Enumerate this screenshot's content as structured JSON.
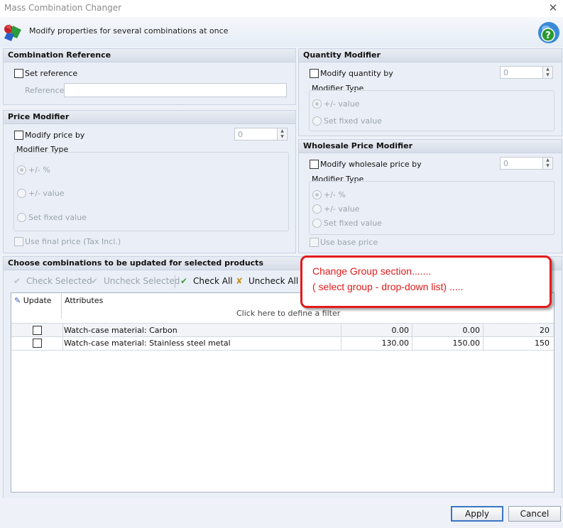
{
  "window": {
    "title": "Mass Combination Changer",
    "close_glyph": "✕"
  },
  "header": {
    "description": "Modify properties for several combinations at once",
    "help_glyph": "?"
  },
  "combination_reference": {
    "title": "Combination Reference",
    "set_reference_label": "Set reference",
    "reference_label": "Reference",
    "reference_value": ""
  },
  "price_modifier": {
    "title": "Price Modifier",
    "modify_label": "Modify price by",
    "value": "0",
    "modifier_type_label": "Modifier Type",
    "options": [
      "+/- %",
      "+/- value",
      "Set fixed value"
    ],
    "use_final_price_label": "Use final price (Tax Incl.)"
  },
  "quantity_modifier": {
    "title": "Quantity Modifier",
    "modify_label": "Modify quantity by",
    "value": "0",
    "modifier_type_label": "Modifier Type",
    "options": [
      "+/- value",
      "Set fixed value"
    ]
  },
  "wholesale_modifier": {
    "title": "Wholesale Price Modifier",
    "modify_label": "Modify wholesale price by",
    "value": "0",
    "modifier_type_label": "Modifier Type",
    "options": [
      "+/- %",
      "+/- value",
      "Set fixed value"
    ],
    "use_base_price_label": "Use base price"
  },
  "combinations": {
    "title": "Choose combinations to be updated for selected products",
    "toolbar": {
      "check_selected": "Check Selected",
      "uncheck_selected": "Uncheck Selected",
      "check_all": "Check All",
      "uncheck_all": "Uncheck All"
    },
    "columns": {
      "update": "Update",
      "attributes": "Attributes"
    },
    "filter_hint": "Click here to define a filter",
    "rows": [
      {
        "attributes": "Watch-case material: Carbon",
        "col3": "0.00",
        "col4": "0.00",
        "col5": "20"
      },
      {
        "attributes": "Watch-case material: Stainless steel metal",
        "col3": "130.00",
        "col4": "150.00",
        "col5": "150"
      }
    ]
  },
  "annotation": {
    "line1": "Change Group section.......",
    "line2": "( select group  - drop-down list) ....."
  },
  "buttons": {
    "apply": "Apply",
    "cancel": "Cancel"
  },
  "colors": {
    "annotation_red": "#e31b1b",
    "panel_bg": "#eaeff7",
    "accent_blue": "#3a74c4"
  }
}
